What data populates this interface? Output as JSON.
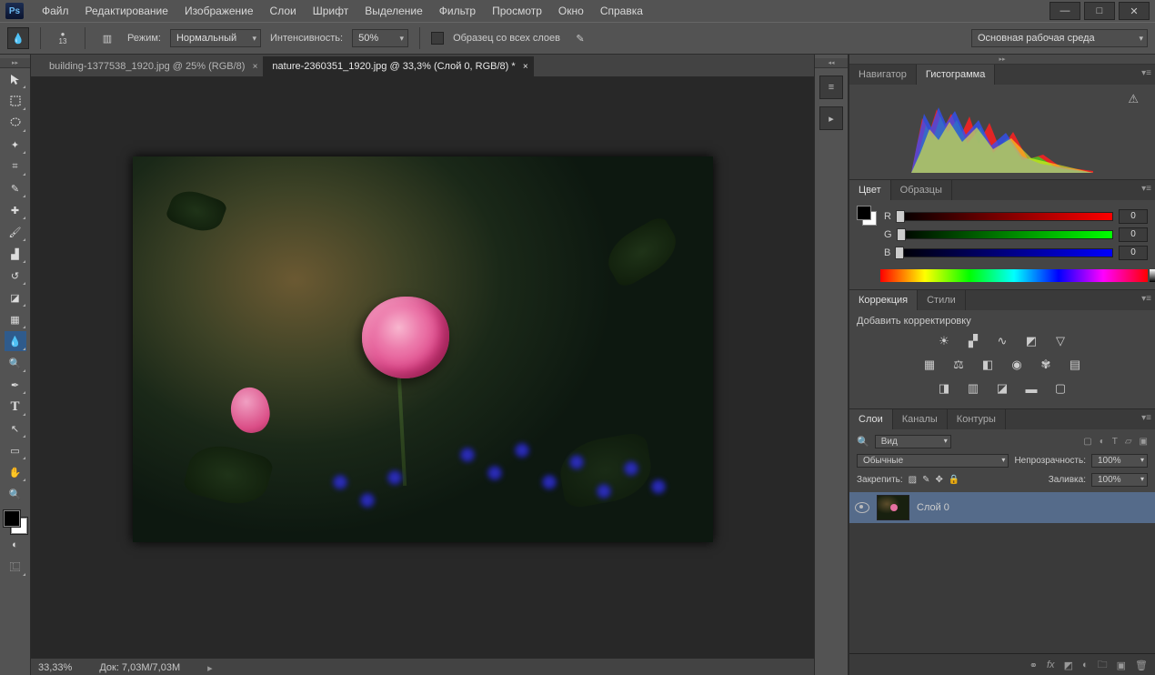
{
  "menu": {
    "items": [
      "Файл",
      "Редактирование",
      "Изображение",
      "Слои",
      "Шрифт",
      "Выделение",
      "Фильтр",
      "Просмотр",
      "Окно",
      "Справка"
    ]
  },
  "optionbar": {
    "brush_size": "13",
    "mode_label": "Режим:",
    "mode_value": "Нормальный",
    "intensity_label": "Интенсивность:",
    "intensity_value": "50%",
    "sample_label": "Образец со всех слоев",
    "workspace": "Основная рабочая среда"
  },
  "tabs": [
    {
      "label": "building-1377538_1920.jpg @ 25% (RGB/8)",
      "active": false
    },
    {
      "label": "nature-2360351_1920.jpg @ 33,3% (Слой 0, RGB/8) *",
      "active": true
    }
  ],
  "status": {
    "zoom": "33,33%",
    "doc": "Док: 7,03M/7,03M"
  },
  "panels": {
    "nav_tab": "Навигатор",
    "histo_tab": "Гистограмма",
    "color_tab": "Цвет",
    "swatch_tab": "Образцы",
    "r": "R",
    "g": "G",
    "b": "B",
    "rv": "0",
    "gv": "0",
    "bv": "0",
    "corr_tab": "Коррекция",
    "styles_tab": "Стили",
    "corr_add": "Добавить корректировку",
    "layers_tab": "Слои",
    "channels_tab": "Каналы",
    "paths_tab": "Контуры",
    "kind": "Вид",
    "blend": "Обычные",
    "opacity_label": "Непрозрачность:",
    "opacity_val": "100%",
    "lock_label": "Закрепить:",
    "fill_label": "Заливка:",
    "fill_val": "100%",
    "layer0": "Слой 0"
  }
}
